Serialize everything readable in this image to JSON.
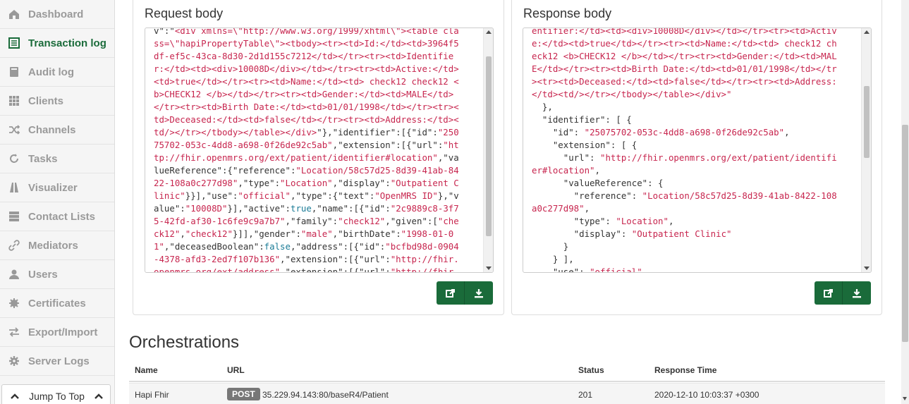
{
  "sidebar": {
    "items": [
      {
        "label": "Dashboard",
        "icon": "home-icon",
        "active": false
      },
      {
        "label": "Transaction log",
        "icon": "list-icon",
        "active": true
      },
      {
        "label": "Audit log",
        "icon": "book-icon",
        "active": false
      },
      {
        "label": "Clients",
        "icon": "grid-icon",
        "active": false
      },
      {
        "label": "Channels",
        "icon": "shuffle-icon",
        "active": false
      },
      {
        "label": "Tasks",
        "icon": "refresh-icon",
        "active": false
      },
      {
        "label": "Visualizer",
        "icon": "road-icon",
        "active": false
      },
      {
        "label": "Contact Lists",
        "icon": "server-icon",
        "active": false
      },
      {
        "label": "Mediators",
        "icon": "link-icon",
        "active": false
      },
      {
        "label": "Users",
        "icon": "user-icon",
        "active": false
      },
      {
        "label": "Certificates",
        "icon": "certificate-icon",
        "active": false
      },
      {
        "label": "Export/Import",
        "icon": "transfer-icon",
        "active": false
      },
      {
        "label": "Server Logs",
        "icon": "gear-icon",
        "active": false
      }
    ],
    "jump_label": "Jump To Top"
  },
  "request": {
    "title": "Request body",
    "lines": [
      [
        [
          "k",
          "v\":\""
        ],
        [
          "s",
          "<div xmlns=\\\"http://www.w3.org/1999/xhtml\\\"><table cla"
        ]
      ],
      [
        [
          "s",
          "ss=\\\"hapiPropertyTable\\\"><tbody><tr><td>Id:</td><td>3964f5"
        ]
      ],
      [
        [
          "s",
          "df-ef5c-43ca-8d30-2d1d155c7212</td></tr><tr><td>Identifie"
        ]
      ],
      [
        [
          "s",
          "r:</td><td><div>10008D</div></td></tr><tr><td>Active:</td>"
        ]
      ],
      [
        [
          "s",
          "<td>true</td></tr><tr><td>Name:</td><td> check12 check12 <"
        ]
      ],
      [
        [
          "s",
          "b>CHECK12 </b></td></tr><tr><td>Gender:</td><td>MALE</td>"
        ]
      ],
      [
        [
          "s",
          "</tr><tr><td>Birth Date:</td><td>01/01/1998</td></tr><tr><"
        ]
      ],
      [
        [
          "s",
          "td>Deceased:</td><td>false</td></tr><tr><td>Address:</td><"
        ]
      ],
      [
        [
          "s",
          "td/></tr></tbody></table></div>"
        ],
        [
          "k",
          "\"},\"identifier\":[{\"id\":"
        ],
        [
          "s",
          "\"250"
        ]
      ],
      [
        [
          "s",
          "75702-053c-4dd8-a698-0f26de92c5ab\""
        ],
        [
          "k",
          ",\"extension\":[{\"url\":"
        ],
        [
          "s",
          "\"ht"
        ]
      ],
      [
        [
          "s",
          "tp://fhir.openmrs.org/ext/patient/identifier#location\""
        ],
        [
          "k",
          ",\"va"
        ]
      ],
      [
        [
          "k",
          "lueReference\":{\"reference\":"
        ],
        [
          "s",
          "\"Location/58c57d25-8d39-41ab-84"
        ]
      ],
      [
        [
          "s",
          "22-108a0c277d98\""
        ],
        [
          "k",
          ",\"type\":"
        ],
        [
          "s",
          "\"Location\""
        ],
        [
          "k",
          ",\"display\":"
        ],
        [
          "s",
          "\"Outpatient C"
        ]
      ],
      [
        [
          "s",
          "linic\""
        ],
        [
          "k",
          "}}],\"use\":"
        ],
        [
          "s",
          "\"official\""
        ],
        [
          "k",
          ",\"type\":{\"text\":"
        ],
        [
          "s",
          "\"OpenMRS ID\""
        ],
        [
          "k",
          "},\"v"
        ]
      ],
      [
        [
          "k",
          "alue\":"
        ],
        [
          "s",
          "\"10008D\""
        ],
        [
          "k",
          "}],\"active\":"
        ],
        [
          "b",
          "true"
        ],
        [
          "k",
          ",\"name\":[{\"id\":"
        ],
        [
          "s",
          "\"2c9889c8-3f7"
        ]
      ],
      [
        [
          "s",
          "5-42fd-af30-1c6fe9c9a7b7\""
        ],
        [
          "k",
          ",\"family\":"
        ],
        [
          "s",
          "\"check12\""
        ],
        [
          "k",
          ",\"given\":["
        ],
        [
          "s",
          "\"che"
        ]
      ],
      [
        [
          "s",
          "ck12\""
        ],
        [
          "k",
          ","
        ],
        [
          "s",
          "\"check12\""
        ],
        [
          "k",
          "}]],\"gender\":"
        ],
        [
          "s",
          "\"male\""
        ],
        [
          "k",
          ",\"birthDate\":"
        ],
        [
          "s",
          "\"1998-01-0"
        ]
      ],
      [
        [
          "s",
          "1\""
        ],
        [
          "k",
          ",\"deceasedBoolean\":"
        ],
        [
          "b",
          "false"
        ],
        [
          "k",
          ",\"address\":[{\"id\":"
        ],
        [
          "s",
          "\"bcfbd98d-0904"
        ]
      ],
      [
        [
          "s",
          "-4378-afd3-2ed7f107b136\""
        ],
        [
          "k",
          ",\"extension\":[{\"url\":"
        ],
        [
          "s",
          "\"http://fhir."
        ]
      ],
      [
        [
          "s",
          "openmrs.org/ext/address\""
        ],
        [
          "k",
          ",\"extension\":[{\"url\":"
        ],
        [
          "s",
          "\"http://fhir."
        ]
      ]
    ]
  },
  "response": {
    "title": "Response body",
    "lines": [
      [
        [
          "s",
          "entifier:</td><td><div>10008D</div></td></tr><tr><td>Activ"
        ]
      ],
      [
        [
          "s",
          "e:</td><td>true</td></tr><tr><td>Name:</td><td> check12 ch"
        ]
      ],
      [
        [
          "s",
          "eck12 <b>CHECK12 </b></td></tr><tr><td>Gender:</td><td>MAL"
        ]
      ],
      [
        [
          "s",
          "E</td></tr><tr><td>Birth Date:</td><td>01/01/1998</td></tr"
        ]
      ],
      [
        [
          "s",
          "><tr><td>Deceased:</td><td>false</td></tr><tr><td>Address:"
        ]
      ],
      [
        [
          "s",
          "</td><td/></tr></tbody></table></div>\""
        ]
      ],
      [
        [
          "k",
          "  },"
        ]
      ],
      [
        [
          "k",
          "  \"identifier\": [ {"
        ]
      ],
      [
        [
          "k",
          "    \"id\": "
        ],
        [
          "s",
          "\"25075702-053c-4dd8-a698-0f26de92c5ab\""
        ],
        [
          "k",
          ","
        ]
      ],
      [
        [
          "k",
          "    \"extension\": [ {"
        ]
      ],
      [
        [
          "k",
          "      \"url\": "
        ],
        [
          "s",
          "\"http://fhir.openmrs.org/ext/patient/identifi"
        ]
      ],
      [
        [
          "s",
          "er#location\""
        ],
        [
          "k",
          ","
        ]
      ],
      [
        [
          "k",
          "      \"valueReference\": {"
        ]
      ],
      [
        [
          "k",
          "        \"reference\": "
        ],
        [
          "s",
          "\"Location/58c57d25-8d39-41ab-8422-108"
        ]
      ],
      [
        [
          "s",
          "a0c277d98\""
        ],
        [
          "k",
          ","
        ]
      ],
      [
        [
          "k",
          "        \"type\": "
        ],
        [
          "s",
          "\"Location\""
        ],
        [
          "k",
          ","
        ]
      ],
      [
        [
          "k",
          "        \"display\": "
        ],
        [
          "s",
          "\"Outpatient Clinic\""
        ]
      ],
      [
        [
          "k",
          "      }"
        ]
      ],
      [
        [
          "k",
          "    } ],"
        ]
      ],
      [
        [
          "k",
          "    \"use\": "
        ],
        [
          "s",
          "\"official\""
        ]
      ]
    ]
  },
  "orchestrations": {
    "title": "Orchestrations",
    "columns": [
      "Name",
      "URL",
      "Status",
      "Response Time"
    ],
    "rows": [
      {
        "name": "Hapi Fhir",
        "method": "POST",
        "url": "35.229.94.143:80/baseR4/Patient",
        "status": "201",
        "time": "2020-12-10 10:03:37 +0300"
      }
    ]
  },
  "colors": {
    "accent": "#1a6b3a",
    "string": "#c7254e",
    "boolean": "#1a7b96"
  }
}
